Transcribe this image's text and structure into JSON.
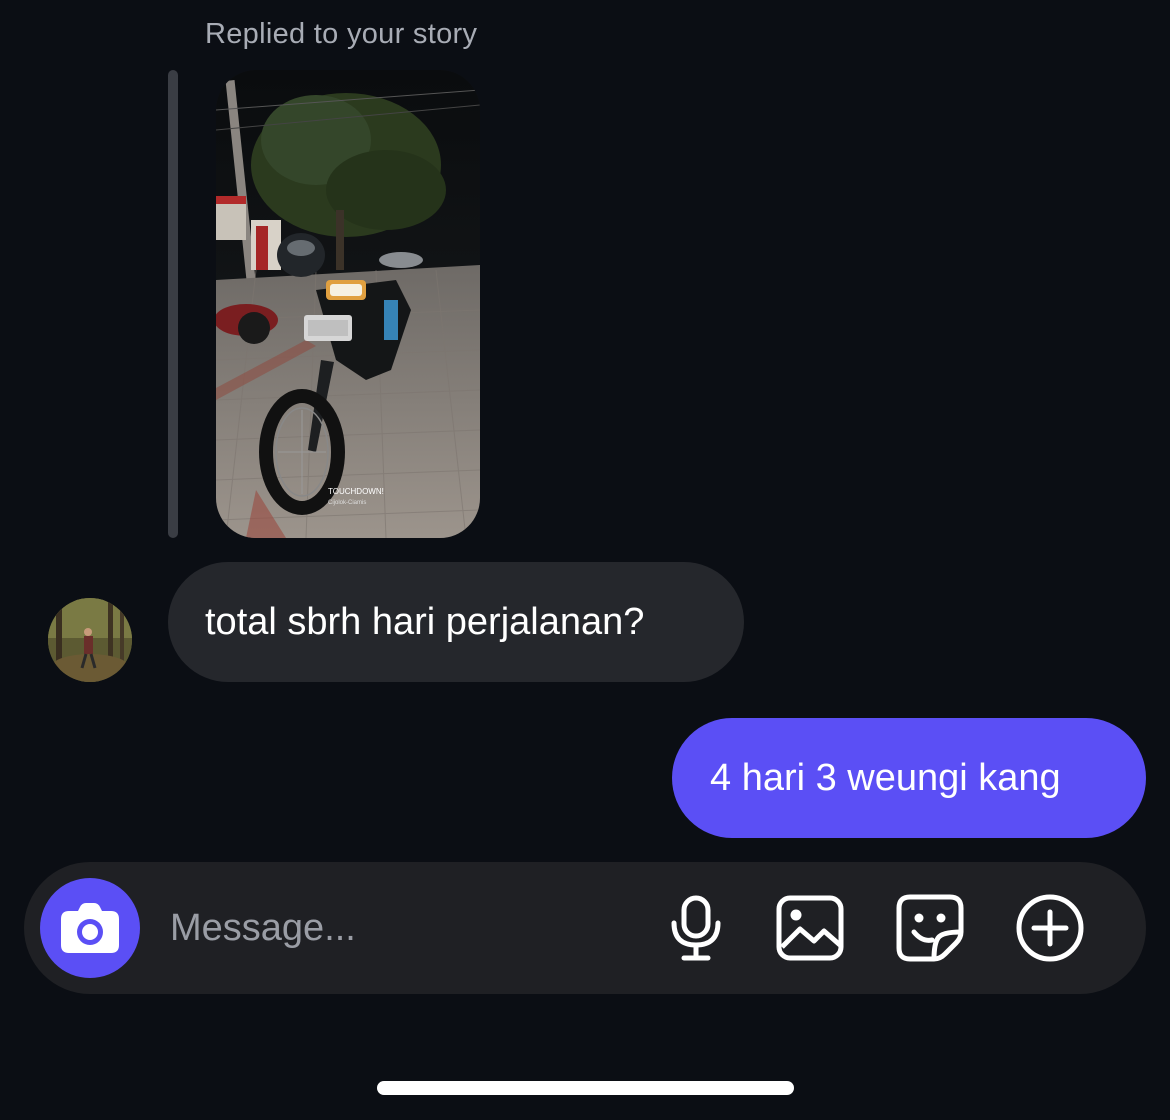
{
  "reply_context": {
    "label": "Replied to your story",
    "story_watermark_line1": "TOUCHDOWN!",
    "story_watermark_line2": "Cijolok-Ciamis"
  },
  "messages": [
    {
      "direction": "incoming",
      "text": "total sbrh hari perjalanan?"
    },
    {
      "direction": "outgoing",
      "text": "4 hari 3 weungi kang"
    }
  ],
  "composer": {
    "placeholder": "Message...",
    "value": "",
    "icons": [
      "camera-icon",
      "microphone-icon",
      "image-icon",
      "sticker-icon",
      "plus-circle-icon"
    ]
  },
  "colors": {
    "background": "#0b0e14",
    "incoming_bubble": "#25272c",
    "outgoing_bubble": "#5b4ff5",
    "composer_bg": "#1f2024",
    "accent": "#5b4ff5"
  }
}
